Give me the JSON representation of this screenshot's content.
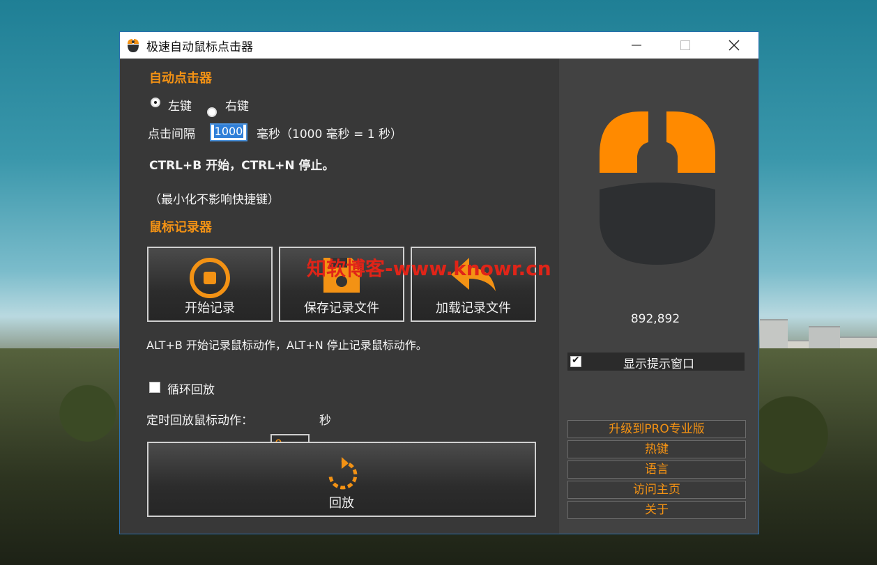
{
  "window": {
    "title": "极速自动鼠标点击器",
    "minimize_icon": "minimize-icon",
    "maximize_icon": "maximize-icon",
    "close_icon": "close-icon"
  },
  "watermark": "知软博客-www.knowr.cn",
  "auto_clicker": {
    "section_title": "自动点击器",
    "left_button_label": "左键",
    "right_button_label": "右键",
    "selected_button": "left",
    "interval_label": "点击间隔",
    "interval_value": "1000",
    "interval_unit_note": "毫秒（1000 毫秒 = 1 秒）",
    "hotkey_note": "CTRL+B 开始，CTRL+N 停止。",
    "minimize_note": "（最小化不影响快捷键）"
  },
  "recorder": {
    "section_title": "鼠标记录器",
    "start_record_label": "开始记录",
    "save_record_label": "保存记录文件",
    "load_record_label": "加载记录文件",
    "hotkey_note": "ALT+B 开始记录鼠标动作，ALT+N 停止记录鼠标动作。",
    "loop_label": "循环回放",
    "loop_checked": false,
    "timer_label": "定时回放鼠标动作：",
    "timer_value": "0",
    "timer_unit": "秒",
    "playback_label": "回放"
  },
  "side_panel": {
    "coordinates": "892,892",
    "show_tip_label": "显示提示窗口",
    "show_tip_checked": true,
    "upgrade_label": "升级到PRO专业版",
    "hotkeys_label": "热键",
    "language_label": "语言",
    "homepage_label": "访问主页",
    "about_label": "关于"
  },
  "colors": {
    "accent": "#f39214",
    "panel_dark": "#383838",
    "panel_side": "#424242",
    "mouse_body": "#2d2f31"
  }
}
